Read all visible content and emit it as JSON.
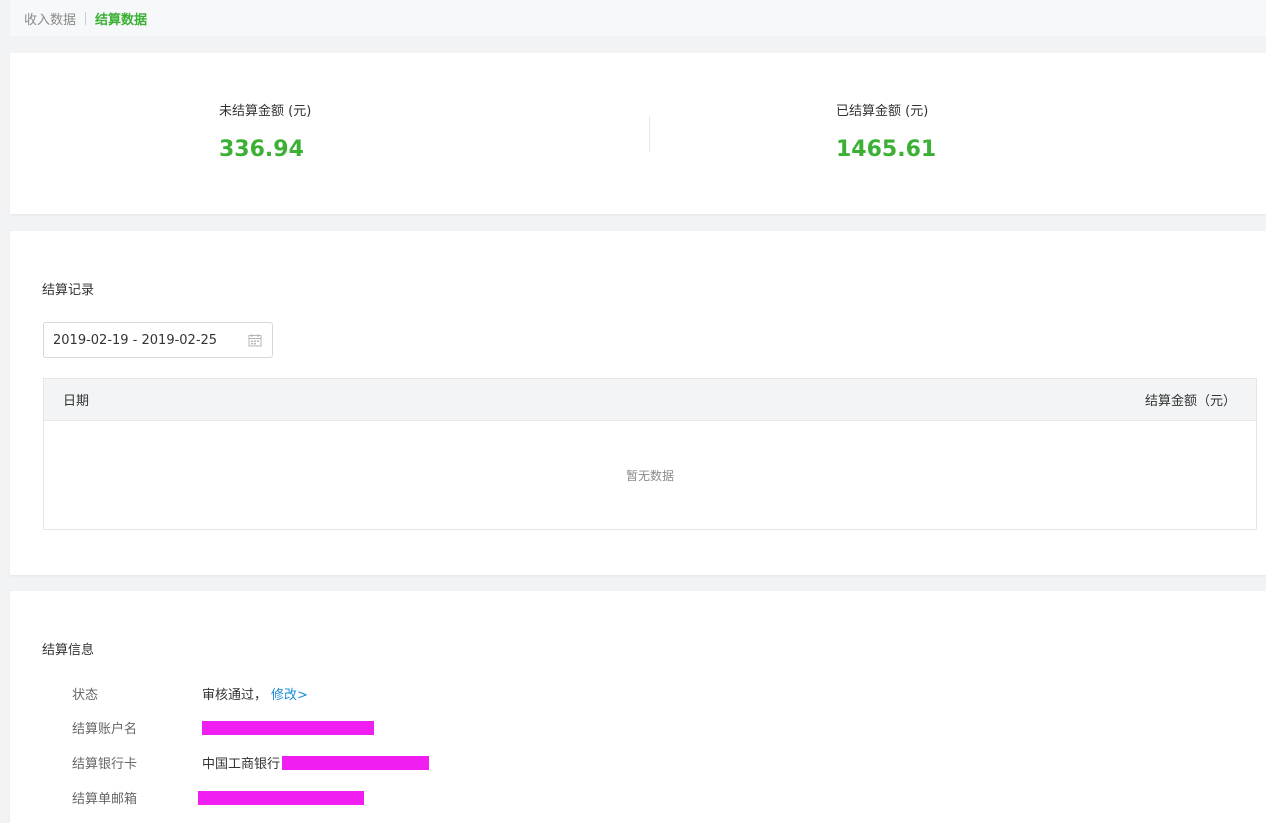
{
  "breadcrumb": {
    "items": [
      "收入数据",
      "结算数据"
    ]
  },
  "summary": {
    "unsettled_label": "未结算金额 (元)",
    "unsettled_value": "336.94",
    "settled_label": "已结算金额 (元)",
    "settled_value": "1465.61"
  },
  "records": {
    "title": "结算记录",
    "date_range": "2019-02-19 - 2019-02-25",
    "columns": [
      "日期",
      "结算金额（元）"
    ],
    "empty_text": "暂无数据"
  },
  "info": {
    "title": "结算信息",
    "rows": [
      {
        "label": "状态",
        "value": "审核通过，",
        "link": "修改>"
      },
      {
        "label": "结算账户名",
        "value": ""
      },
      {
        "label": "结算银行卡",
        "value": "中国工商银行"
      },
      {
        "label": "结算单邮箱",
        "value": ""
      }
    ]
  },
  "colors": {
    "accent_green": "#3cb035",
    "link_blue": "#1a8cd8",
    "redaction": "#f01ef0"
  }
}
